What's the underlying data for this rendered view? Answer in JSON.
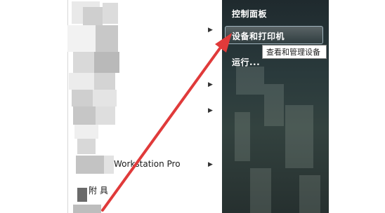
{
  "start_menu": {
    "right_items": [
      {
        "label": "控制面板"
      },
      {
        "label": "设备和打印机"
      },
      {
        "label": "运行..."
      }
    ],
    "tooltip": "查看和管理设备",
    "left_programs": [
      {
        "label": "Workstation Pro"
      },
      {
        "label": "附 具"
      }
    ]
  },
  "annotation": {
    "color": "#e03a3a"
  }
}
